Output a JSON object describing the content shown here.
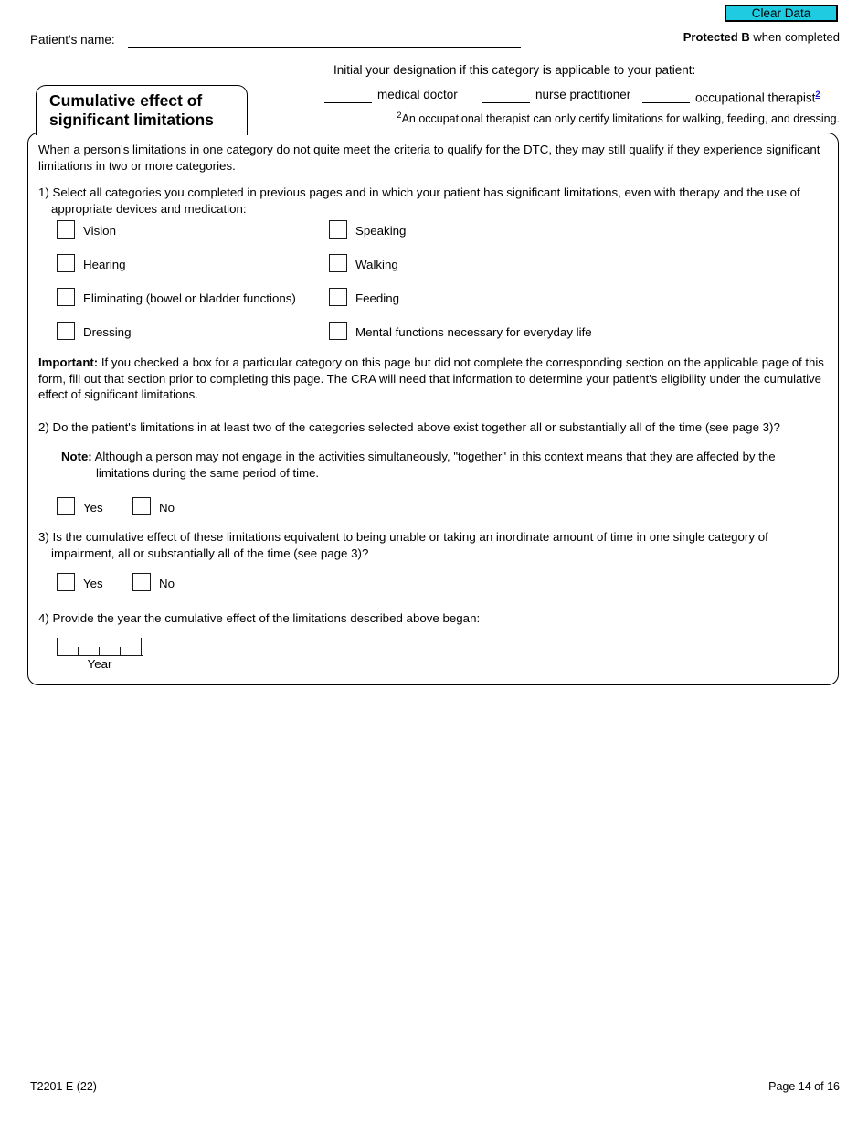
{
  "header": {
    "clear_data_label": "Clear Data",
    "protected_bold": "Protected B",
    "protected_rest": " when completed",
    "patient_name_label": "Patient's name:"
  },
  "designation": {
    "intro": "Initial your designation if this category is applicable to your patient:",
    "options": [
      {
        "label": "medical doctor"
      },
      {
        "label": "nurse practitioner"
      },
      {
        "label": "occupational therapist"
      }
    ],
    "superscript_link": "2",
    "footnote_marker": "2",
    "footnote_text": "An occupational therapist can only certify limitations for walking, feeding, and dressing."
  },
  "section": {
    "title_line1": "Cumulative effect of",
    "title_line2": "significant limitations",
    "intro": "When a person's limitations in one category do not quite meet the criteria to qualify for the DTC, they may still qualify if they experience significant limitations in two or more categories.",
    "q1": "1) Select all categories you completed in previous pages and in which your patient has significant limitations, even with therapy and the use of appropriate devices and medication:",
    "categories_col1": [
      "Vision",
      "Hearing",
      "Eliminating (bowel or bladder functions)",
      "Dressing"
    ],
    "categories_col2": [
      "Speaking",
      "Walking",
      "Feeding",
      "Mental functions necessary for everyday life"
    ],
    "important_label": "Important:",
    "important_text": " If you checked a box for a particular category on this page but did not complete the corresponding section on the applicable page of this form, fill out that section prior to completing this page. The CRA will need that information to determine your patient's eligibility under the cumulative effect of significant limitations.",
    "q2": "2) Do the patient's limitations in at least two of the categories selected above exist together all or substantially all of the time (see page 3)?",
    "note_label": "Note:",
    "note_text": " Although a person may not engage in the activities simultaneously, \"together\" in this context means that they are affected by the limitations during the same period of time.",
    "q2_yes": "Yes",
    "q2_no": "No",
    "q3": "3) Is the cumulative effect of these limitations equivalent to being unable or taking an inordinate amount of time in one single category of impairment, all or substantially all of the time (see page 3)?",
    "q3_yes": "Yes",
    "q3_no": "No",
    "q4": "4) Provide the year the cumulative effect of the limitations described above began:",
    "year_label": "Year",
    "year_value": ""
  },
  "footer": {
    "form_code": "T2201 E (22)",
    "page_number": "Page 14 of 16"
  },
  "colors": {
    "clear_data_bg": "#1ecbe1",
    "link_blue": "#1515cf",
    "border_black": "#000000"
  }
}
